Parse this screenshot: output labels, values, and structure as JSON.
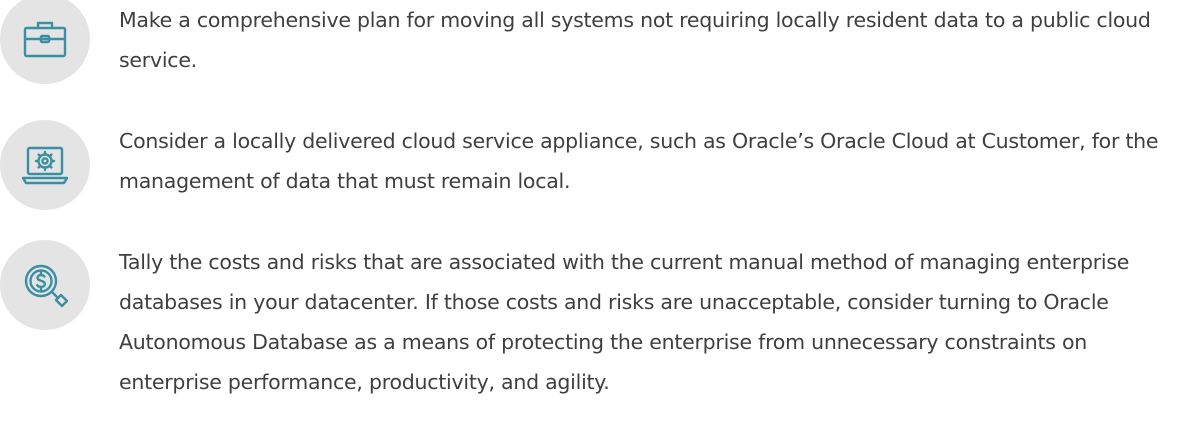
{
  "accent_color": "#3a8fa3",
  "icon_background_color": "#e4e4e4",
  "text_color": "#3f3f3f",
  "items": [
    {
      "icon": "briefcase-icon",
      "text": "Make a comprehensive plan for moving all systems not requiring locally resident data to a public cloud service."
    },
    {
      "icon": "laptop-gear-icon",
      "text": "Consider a locally delivered cloud service appliance, such as Oracle’s Oracle Cloud at Customer, for the management of data that must remain local."
    },
    {
      "icon": "dollar-search-icon",
      "text": "Tally the costs and risks that are associated with the current manual method of managing enterprise databases in your datacenter. If those costs and risks are unacceptable, consider turning to Oracle Autonomous Database as a means of protecting the enterprise from unnecessary constraints on enterprise performance, productivity, and agility."
    }
  ]
}
